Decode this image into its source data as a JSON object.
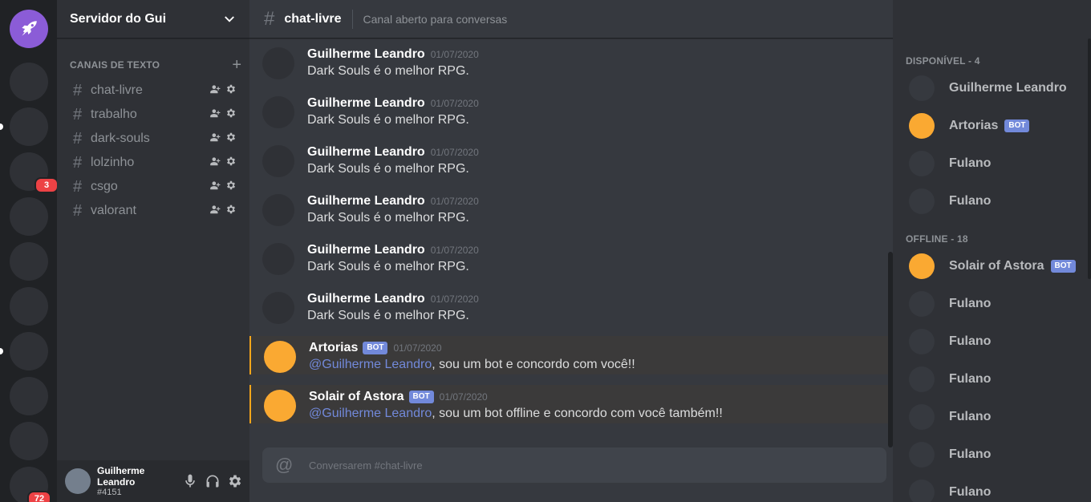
{
  "colors": {
    "accent": "#7289da",
    "brand": "#8b5cd7",
    "bot_avatar": "#faa932",
    "mention_badge": "#ed4245"
  },
  "servers": {
    "badges": {
      "first": "3",
      "second": "72"
    }
  },
  "sidebar": {
    "server_name": "Servidor do Gui",
    "category": "CANAIS DE TEXTO",
    "channels": [
      {
        "label": "chat-livre"
      },
      {
        "label": "trabalho"
      },
      {
        "label": "dark-souls"
      },
      {
        "label": "lolzinho"
      },
      {
        "label": "csgo"
      },
      {
        "label": "valorant"
      }
    ]
  },
  "user": {
    "name": "Guilherme Leandro",
    "tag": "#4151"
  },
  "header": {
    "channel": "chat-livre",
    "topic": "Canal aberto para conversas"
  },
  "messages": [
    {
      "author": "Guilherme Leandro",
      "time": "01/07/2020",
      "text": "Dark Souls é o melhor RPG."
    },
    {
      "author": "Guilherme Leandro",
      "time": "01/07/2020",
      "text": "Dark Souls é o melhor RPG."
    },
    {
      "author": "Guilherme Leandro",
      "time": "01/07/2020",
      "text": "Dark Souls é o melhor RPG."
    },
    {
      "author": "Guilherme Leandro",
      "time": "01/07/2020",
      "text": "Dark Souls é o melhor RPG."
    },
    {
      "author": "Guilherme Leandro",
      "time": "01/07/2020",
      "text": "Dark Souls é o melhor RPG."
    },
    {
      "author": "Guilherme Leandro",
      "time": "01/07/2020",
      "text": "Dark Souls é o melhor RPG."
    },
    {
      "author": "Artorias",
      "bot": "BOT",
      "time": "01/07/2020",
      "mention": "@Guilherme Leandro",
      "text": ", sou um bot e concordo com você!!"
    },
    {
      "author": "Solair of Astora",
      "bot": "BOT",
      "time": "01/07/2020",
      "mention": "@Guilherme Leandro",
      "text": ", sou um bot offline e concordo com você também!!"
    }
  ],
  "composer": {
    "placeholder": "Conversarem #chat-livre"
  },
  "members": {
    "online_label": "DISPONÍVEL - 4",
    "online": [
      {
        "name": "Guilherme Leandro"
      },
      {
        "name": "Artorias",
        "bot": "BOT"
      },
      {
        "name": "Fulano"
      },
      {
        "name": "Fulano"
      }
    ],
    "offline_label": "OFFLINE - 18",
    "offline": [
      {
        "name": "Solair of Astora",
        "bot": "BOT"
      },
      {
        "name": "Fulano"
      },
      {
        "name": "Fulano"
      },
      {
        "name": "Fulano"
      },
      {
        "name": "Fulano"
      },
      {
        "name": "Fulano"
      },
      {
        "name": "Fulano"
      }
    ]
  }
}
